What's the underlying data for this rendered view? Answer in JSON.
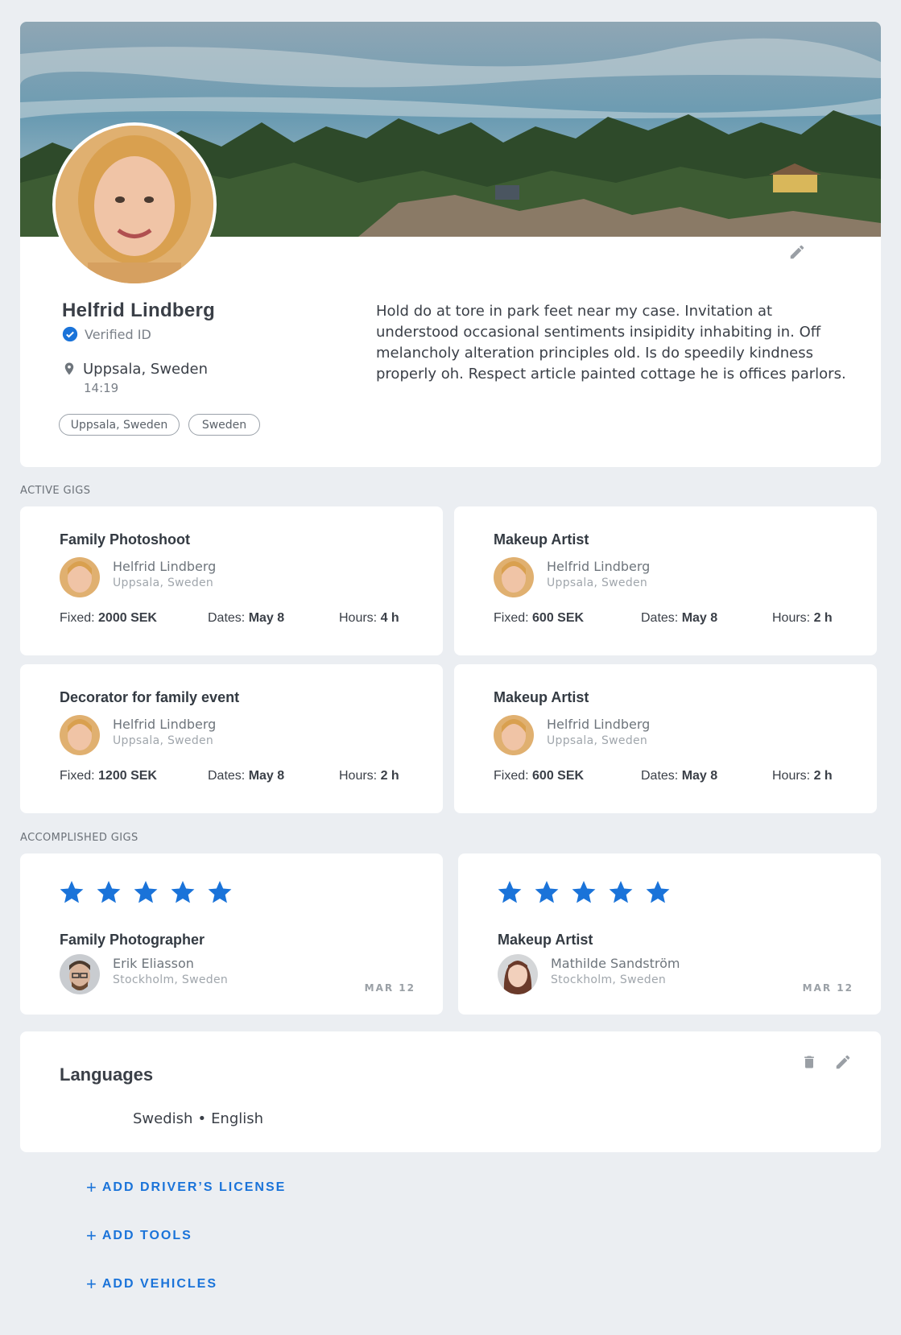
{
  "profile": {
    "name": "Helfrid Lindberg",
    "verified_label": "Verified ID",
    "location": "Uppsala, Sweden",
    "local_time": "14:19",
    "tags": [
      "Uppsala, Sweden",
      "Sweden"
    ],
    "bio": "Hold do at tore in park feet near my case. Invitation at understood occasional sentiments insipidity inhabiting in. Off melancholy alteration principles old. Is do speedily kindness properly oh. Respect article painted cottage he is offices parlors.",
    "edit_icon": "pencil-icon"
  },
  "active_gigs": {
    "label": "ACTIVE GIGS",
    "items": [
      {
        "title": "Family Photoshoot",
        "person": "Helfrid Lindberg",
        "person_location": "Uppsala, Sweden",
        "fixed_label": "Fixed:",
        "fixed": "2000 SEK",
        "dates_label": "Dates:",
        "dates": "May 8",
        "hours_label": "Hours:",
        "hours": "4 h"
      },
      {
        "title": "Makeup Artist",
        "person": "Helfrid Lindberg",
        "person_location": "Uppsala, Sweden",
        "fixed_label": "Fixed:",
        "fixed": "600 SEK",
        "dates_label": "Dates:",
        "dates": "May 8",
        "hours_label": "Hours:",
        "hours": "2 h"
      },
      {
        "title": "Decorator for family event",
        "person": "Helfrid Lindberg",
        "person_location": "Uppsala, Sweden",
        "fixed_label": "Fixed:",
        "fixed": "1200 SEK",
        "dates_label": "Dates:",
        "dates": "May 8",
        "hours_label": "Hours:",
        "hours": "2 h"
      },
      {
        "title": "Makeup Artist",
        "person": "Helfrid Lindberg",
        "person_location": "Uppsala, Sweden",
        "fixed_label": "Fixed:",
        "fixed": "600 SEK",
        "dates_label": "Dates:",
        "dates": "May 8",
        "hours_label": "Hours:",
        "hours": "2 h"
      }
    ]
  },
  "accomplished_gigs": {
    "label": "ACCOMPLISHED GIGS",
    "items": [
      {
        "rating": 5,
        "title": "Family Photographer",
        "person": "Erik Eliasson",
        "person_location": "Stockholm, Sweden",
        "date": "MAR 12"
      },
      {
        "rating": 5,
        "title": "Makeup Artist",
        "person": "Mathilde Sandström",
        "person_location": "Stockholm, Sweden",
        "date": "MAR 12"
      }
    ]
  },
  "languages": {
    "title": "Languages",
    "items": [
      "Swedish",
      "English"
    ],
    "separator": "•",
    "delete_icon": "trash-icon",
    "edit_icon": "pencil-icon"
  },
  "actions": {
    "add_drivers_license": "ADD DRIVER’S LICENSE",
    "add_tools": "ADD TOOLS",
    "add_vehicles": "ADD VEHICLES",
    "plus": "+"
  },
  "colors": {
    "accent": "#1a73d9",
    "background": "#ebeef2",
    "card": "#ffffff",
    "star": "#1a73d9"
  }
}
